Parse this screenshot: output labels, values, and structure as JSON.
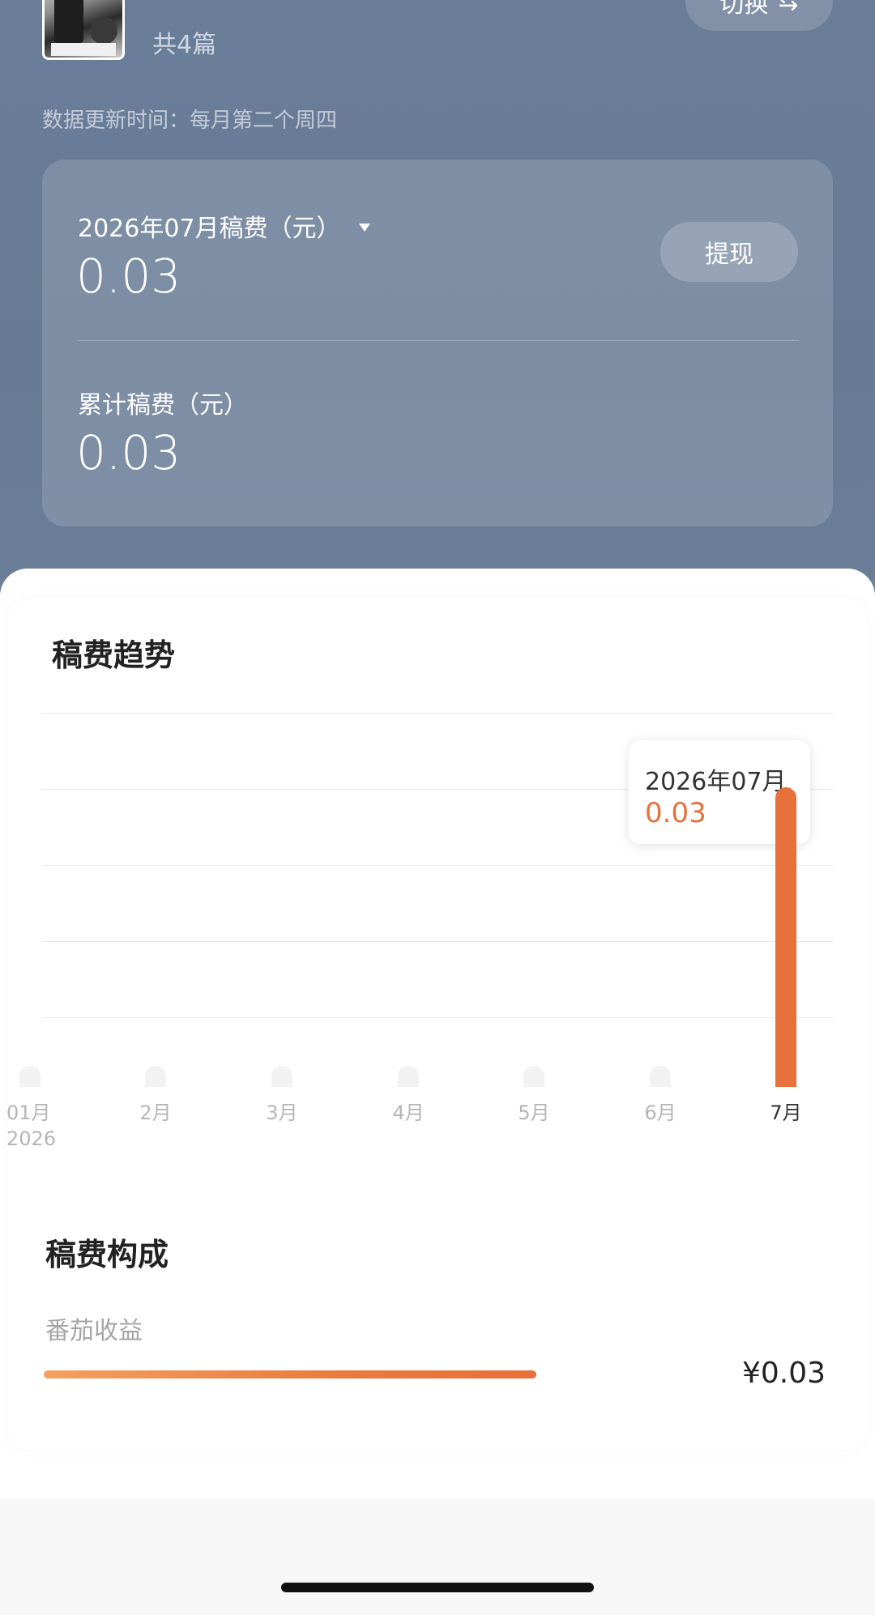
{
  "header": {
    "article_count": "共4篇",
    "switch_label": "切换",
    "switch_icon": "swap-arrows-icon",
    "update_time": "数据更新时间：每月第二个周四"
  },
  "earnings": {
    "month_label": "2026年07月稿费（元）",
    "month_value": "0.03",
    "withdraw_label": "提现",
    "total_label": "累计稿费（元）",
    "total_value": "0.03"
  },
  "trend": {
    "title": "稿费趋势",
    "tooltip_date": "2026年07月",
    "tooltip_value": "0.03",
    "year_label": "2026"
  },
  "chart_data": {
    "type": "bar",
    "categories": [
      "01月",
      "2月",
      "3月",
      "4月",
      "5月",
      "6月",
      "7月"
    ],
    "values": [
      0,
      0,
      0,
      0,
      0,
      0,
      0.03
    ],
    "title": "稿费趋势",
    "xlabel": "",
    "ylabel": "",
    "ylim": [
      0,
      0.0375
    ],
    "grid": true,
    "highlight_index": 6,
    "bar_color": "#e8703a"
  },
  "composition": {
    "title": "稿费构成",
    "items": [
      {
        "label": "番茄收益",
        "amount": "¥0.03",
        "fill_fraction": 1.0
      }
    ]
  },
  "colors": {
    "header_bg": "#6a7d98",
    "accent": "#e8703a"
  }
}
